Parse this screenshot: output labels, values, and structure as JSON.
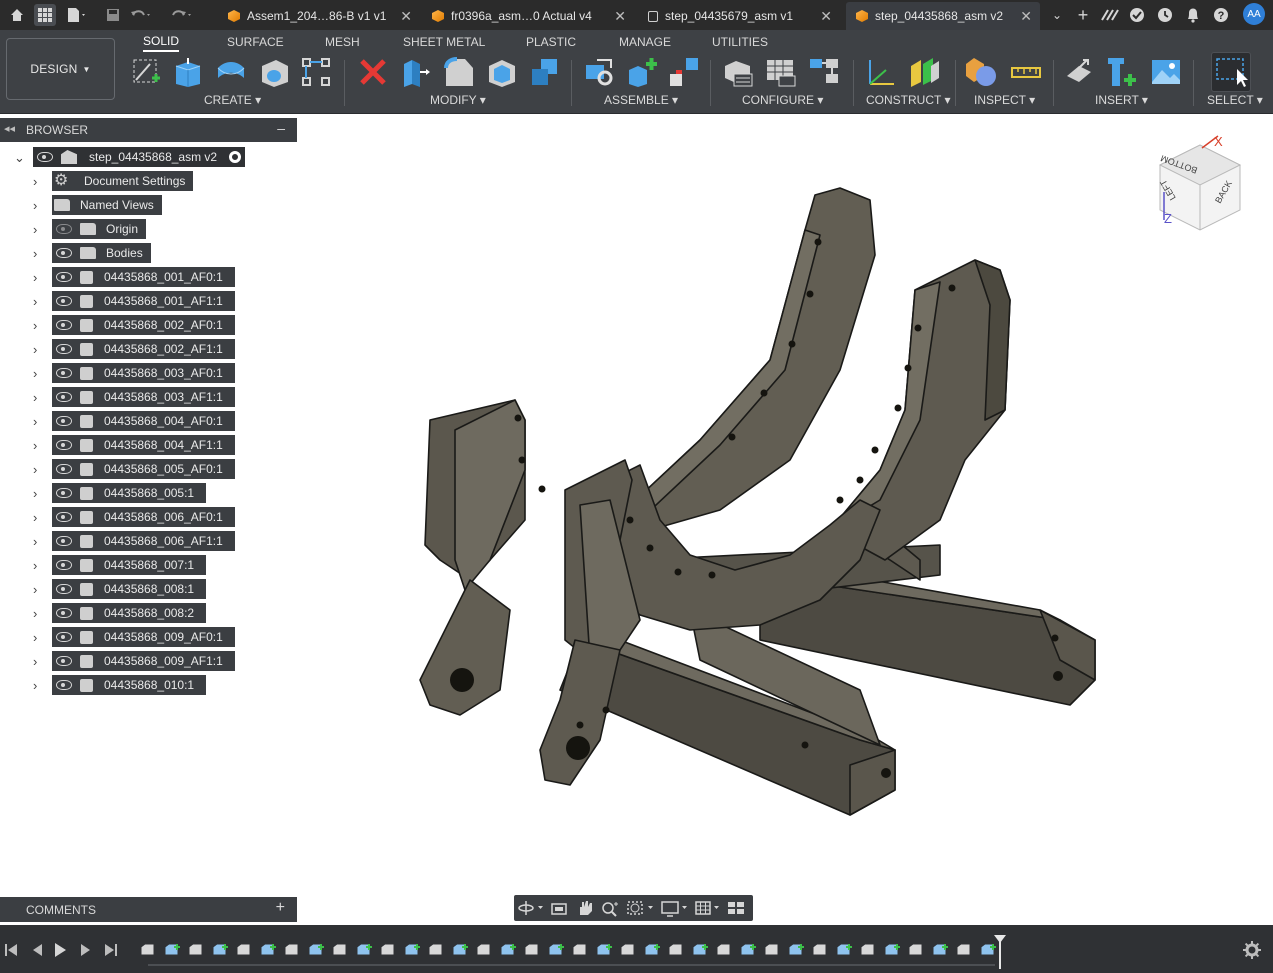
{
  "tabs": [
    {
      "label": "Assem1_204…86-B v1 v1",
      "icon": "component-cube-icon"
    },
    {
      "label": "fr0396a_asm…0 Actual v4",
      "icon": "component-cube-icon"
    },
    {
      "label": "step_04435679_asm v1",
      "icon": "lock-icon"
    },
    {
      "label": "step_04435868_asm v2",
      "icon": "component-cube-icon",
      "active": true
    }
  ],
  "user": {
    "initials": "AA"
  },
  "workspace": {
    "label": "DESIGN"
  },
  "ribbon_tabs": [
    "SOLID",
    "SURFACE",
    "MESH",
    "SHEET METAL",
    "PLASTIC",
    "MANAGE",
    "UTILITIES"
  ],
  "tool_groups": [
    "CREATE",
    "MODIFY",
    "ASSEMBLE",
    "CONFIGURE",
    "CONSTRUCT",
    "INSPECT",
    "INSERT",
    "SELECT"
  ],
  "browser": {
    "title": "BROWSER",
    "root": "step_04435868_asm v2",
    "folders": [
      {
        "label": "Document Settings",
        "icon": "gear-icon",
        "eye": false
      },
      {
        "label": "Named Views",
        "icon": "folder-icon",
        "eye": false
      },
      {
        "label": "Origin",
        "icon": "folder-icon",
        "eye": "hidden"
      },
      {
        "label": "Bodies",
        "icon": "folder-icon",
        "eye": "visible"
      }
    ],
    "components": [
      "04435868_001_AF0:1",
      "04435868_001_AF1:1",
      "04435868_002_AF0:1",
      "04435868_002_AF1:1",
      "04435868_003_AF0:1",
      "04435868_003_AF1:1",
      "04435868_004_AF0:1",
      "04435868_004_AF1:1",
      "04435868_005_AF0:1",
      "04435868_005:1",
      "04435868_006_AF0:1",
      "04435868_006_AF1:1",
      "04435868_007:1",
      "04435868_008:1",
      "04435868_008:2",
      "04435868_009_AF0:1",
      "04435868_009_AF1:1",
      "04435868_010:1"
    ]
  },
  "comments": {
    "title": "COMMENTS"
  },
  "viewcube": {
    "faces": [
      "BOTTOM",
      "LEFT",
      "BACK"
    ],
    "axes": [
      "X",
      "Z"
    ]
  },
  "colors": {
    "toolbar": "#3e4145",
    "titlebar": "#2b2b2b",
    "panel": "#3b3e42",
    "model": "#5e5a50",
    "accent": "#2f7fd7"
  }
}
